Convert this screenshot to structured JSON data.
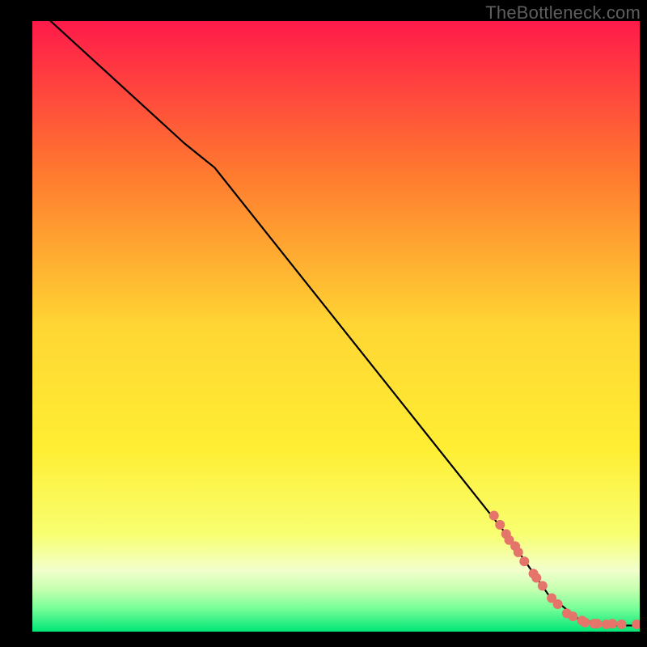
{
  "watermark": "TheBottleneck.com",
  "colors": {
    "gradient_top": "#ff1a4a",
    "gradient_mid1": "#ff8a2a",
    "gradient_mid2": "#ffee33",
    "gradient_mid3": "#f8ff70",
    "gradient_mid4": "#a8ff80",
    "gradient_bottom": "#00e676",
    "line": "#000000",
    "marker": "#e5746b",
    "frame": "#000000"
  },
  "chart_data": {
    "type": "line",
    "title": "",
    "xlabel": "",
    "ylabel": "",
    "xlim": [
      0,
      100
    ],
    "ylim": [
      0,
      100
    ],
    "legend": false,
    "grid": false,
    "series": [
      {
        "name": "curve",
        "kind": "line",
        "x": [
          3,
          25,
          30,
          78,
          85,
          90,
          95,
          100
        ],
        "y": [
          100,
          80,
          76,
          16,
          6,
          2,
          1,
          1
        ]
      },
      {
        "name": "markers",
        "kind": "scatter",
        "x": [
          76,
          77,
          78,
          78.5,
          79.5,
          80,
          81,
          82.5,
          83,
          84,
          85.5,
          86.5,
          88,
          89,
          90.5,
          91,
          92.5,
          93,
          94.5,
          95.5,
          97,
          99.5
        ],
        "y": [
          19,
          17.5,
          16,
          15,
          14,
          13,
          11.5,
          9.5,
          8.8,
          7.5,
          5.5,
          4.5,
          3,
          2.5,
          1.8,
          1.5,
          1.3,
          1.3,
          1.2,
          1.3,
          1.2,
          1.2
        ]
      }
    ]
  }
}
